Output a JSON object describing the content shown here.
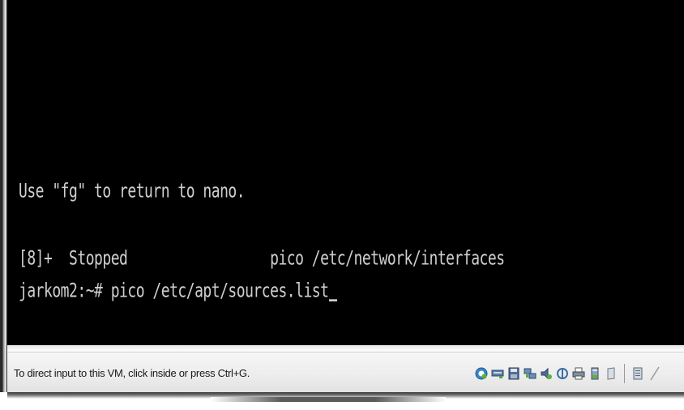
{
  "terminal": {
    "lines": [
      "Use \"fg\" to return to nano.",
      "",
      "[8]+  Stopped                 pico /etc/network/interfaces",
      "jarkom2:~# pico /etc/apt/sources.list"
    ]
  },
  "statusbar": {
    "hint": "To direct input to this VM, click inside or press Ctrl+G."
  },
  "tray": {
    "icons": [
      "vmware-tools-icon",
      "network-adapter-icon",
      "floppy-drive-icon",
      "network-activity-icon",
      "sound-icon",
      "usb-icon",
      "printer-icon",
      "hard-disk-icon",
      "cd-drive-icon",
      "message-log-icon"
    ]
  }
}
